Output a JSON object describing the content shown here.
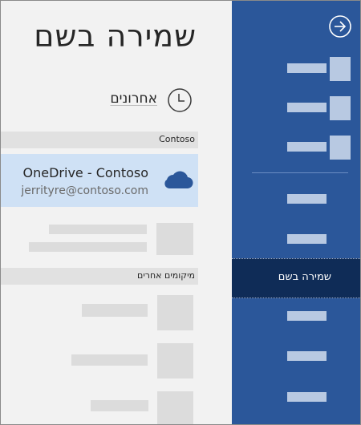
{
  "page": {
    "title": "שמירה בשם"
  },
  "recent": {
    "label": "אחרונים"
  },
  "sections": {
    "contoso": "Contoso",
    "other_locations": "מיקומים אחרים"
  },
  "onedrive": {
    "name": "OneDrive - Contoso",
    "email": "jerrityre@contoso.com"
  },
  "rail": {
    "selected_label": "שמירה בשם"
  },
  "colors": {
    "rail_bg": "#2b579a",
    "rail_selected": "#0f2c57",
    "onedrive_highlight": "#cfe1f5",
    "cloud": "#2b579a"
  }
}
